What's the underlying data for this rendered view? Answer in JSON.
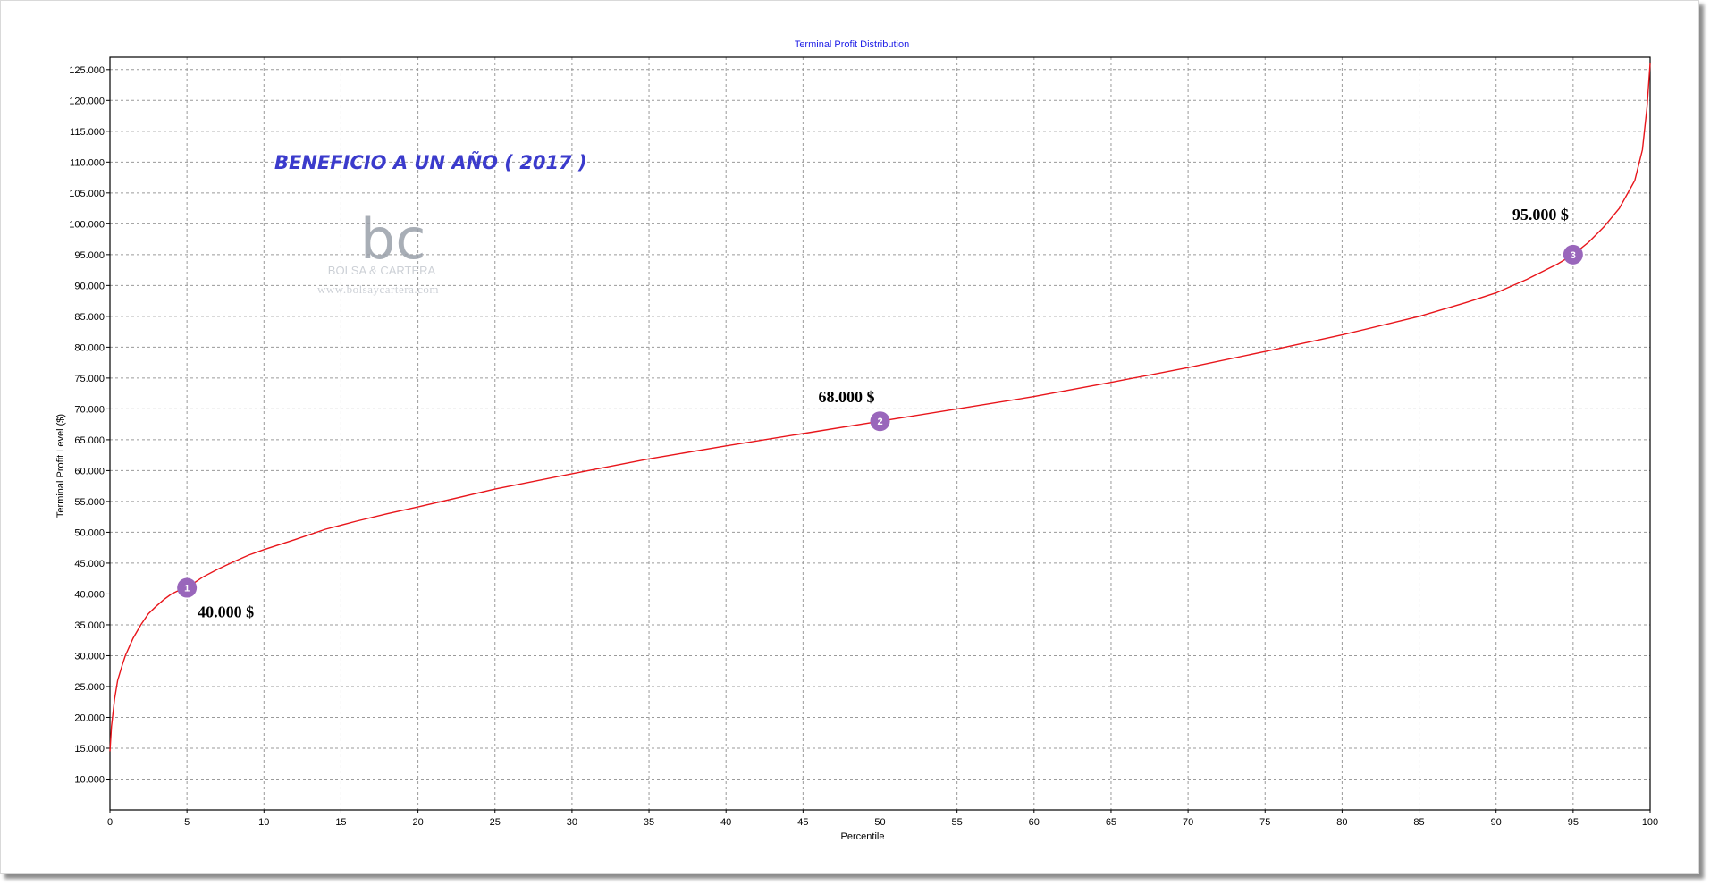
{
  "chart_data": {
    "type": "line",
    "title": "Terminal Profit Distribution",
    "xlabel": "Percentile",
    "ylabel": "Terminal Profit Level ($)",
    "xlim": [
      0,
      100
    ],
    "ylim": [
      5000,
      127000
    ],
    "grid": true,
    "x_ticks": [
      0,
      5,
      10,
      15,
      20,
      25,
      30,
      35,
      40,
      45,
      50,
      55,
      60,
      65,
      70,
      75,
      80,
      85,
      90,
      95,
      100
    ],
    "y_ticks": [
      10000,
      15000,
      20000,
      25000,
      30000,
      35000,
      40000,
      45000,
      50000,
      55000,
      60000,
      65000,
      70000,
      75000,
      80000,
      85000,
      90000,
      95000,
      100000,
      105000,
      110000,
      115000,
      120000,
      125000
    ],
    "y_tick_labels": [
      "10.000",
      "15.000",
      "20.000",
      "25.000",
      "30.000",
      "35.000",
      "40.000",
      "45.000",
      "50.000",
      "55.000",
      "60.000",
      "65.000",
      "70.000",
      "75.000",
      "80.000",
      "85.000",
      "90.000",
      "95.000",
      "100.000",
      "105.000",
      "110.000",
      "115.000",
      "120.000",
      "125.000"
    ],
    "series": [
      {
        "color": "#e8151b",
        "x": [
          0,
          0.1,
          0.3,
          0.5,
          0.8,
          1,
          1.5,
          2,
          2.5,
          3,
          3.5,
          4,
          4.5,
          5,
          6,
          7,
          8,
          9,
          10,
          12,
          14,
          16,
          18,
          20,
          25,
          30,
          35,
          40,
          45,
          50,
          55,
          60,
          65,
          70,
          75,
          80,
          85,
          88,
          90,
          92,
          94,
          95,
          96,
          97,
          98,
          99,
          99.5,
          99.8,
          100
        ],
        "y": [
          14500,
          18500,
          23000,
          26000,
          28500,
          30000,
          32800,
          35000,
          36800,
          38000,
          39100,
          40000,
          40600,
          41000,
          42700,
          44000,
          45200,
          46300,
          47200,
          48800,
          50500,
          51800,
          53000,
          54100,
          57000,
          59500,
          61900,
          64000,
          66000,
          68000,
          70000,
          72000,
          74300,
          76700,
          79300,
          82000,
          85000,
          87200,
          88800,
          91000,
          93500,
          95000,
          97000,
          99500,
          102500,
          107000,
          112000,
          119000,
          126000
        ]
      }
    ],
    "annotations": [
      {
        "num": "1",
        "x": 5,
        "y": 41000,
        "label": "40.000 $"
      },
      {
        "num": "2",
        "x": 50,
        "y": 68000,
        "label": "68.000 $"
      },
      {
        "num": "3",
        "x": 95,
        "y": 95000,
        "label": "95.000 $"
      }
    ],
    "heading": "BENEFICIO A UN AÑO ( 2017 )",
    "colors": {
      "title": "#1e1ee6",
      "heading": "#3b3bcc",
      "marker": "#9966bb",
      "line": "#e8151b",
      "watermark": "#9aa0aa"
    }
  },
  "watermark": {
    "logo_text": "bc",
    "brand": "BOLSA & CARTERA",
    "url": "www.bolsaycartera.com"
  }
}
